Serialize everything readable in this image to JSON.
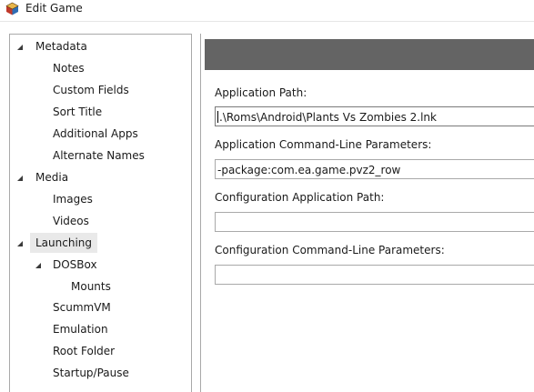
{
  "window": {
    "title": "Edit Game"
  },
  "tree": {
    "items": [
      {
        "label": "Metadata",
        "expanded": true
      },
      {
        "label": "Notes"
      },
      {
        "label": "Custom Fields"
      },
      {
        "label": "Sort Title"
      },
      {
        "label": "Additional Apps"
      },
      {
        "label": "Alternate Names"
      },
      {
        "label": "Media",
        "expanded": true
      },
      {
        "label": "Images"
      },
      {
        "label": "Videos"
      },
      {
        "label": "Launching",
        "expanded": true,
        "selected": true
      },
      {
        "label": "DOSBox",
        "expanded": true
      },
      {
        "label": "Mounts"
      },
      {
        "label": "ScummVM"
      },
      {
        "label": "Emulation"
      },
      {
        "label": "Root Folder"
      },
      {
        "label": "Startup/Pause"
      }
    ]
  },
  "form": {
    "application_path": {
      "label": "Application Path:",
      "value": ".\\Roms\\Android\\Plants Vs Zombies 2.lnk"
    },
    "application_params": {
      "label": "Application Command-Line Parameters:",
      "value": "-package:com.ea.game.pvz2_row"
    },
    "config_app_path": {
      "label": "Configuration Application Path:",
      "value": ""
    },
    "config_params": {
      "label": "Configuration Command-Line Parameters:",
      "value": ""
    }
  },
  "colors": {
    "header_bar": "#646464",
    "border": "#a9a9a9",
    "selected_bg": "#e9e9e9"
  }
}
